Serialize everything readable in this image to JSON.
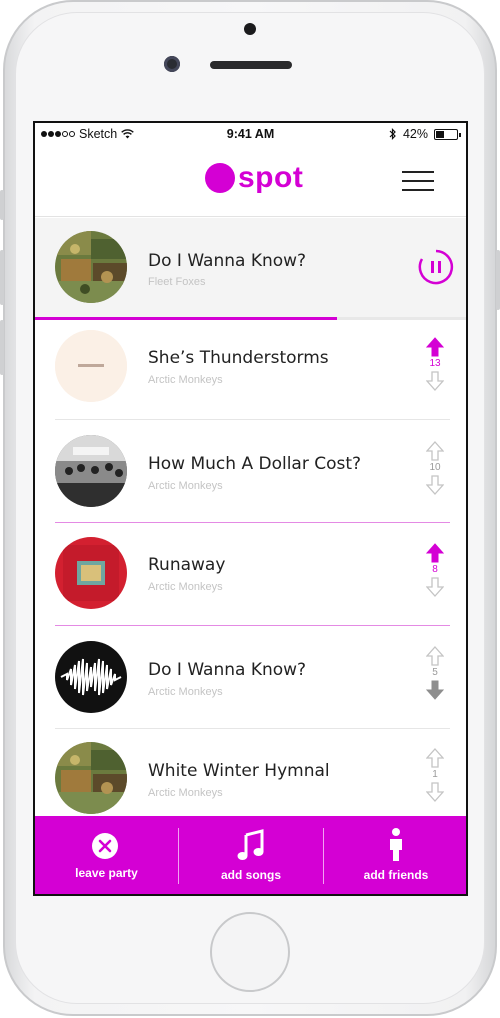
{
  "status": {
    "carrier": "Sketch",
    "time": "9:41 AM",
    "battery": "42%",
    "battery_level": 0.42
  },
  "brand": {
    "name": "spot",
    "color": "#d400d4"
  },
  "now_playing": {
    "title": "Do I Wanna Know?",
    "artist": "Fleet Foxes",
    "progress": 0.7,
    "state_icon": "pause-icon"
  },
  "queue": [
    {
      "title": "She’s Thunderstorms",
      "artist": "Arctic Monkeys",
      "votes": "13",
      "upvoted": true,
      "downvoted": false
    },
    {
      "title": "How Much A Dollar Cost?",
      "artist": "Arctic Monkeys",
      "votes": "10",
      "upvoted": false,
      "downvoted": false
    },
    {
      "title": "Runaway",
      "artist": "Arctic Monkeys",
      "votes": "8",
      "upvoted": true,
      "downvoted": false
    },
    {
      "title": "Do I Wanna Know?",
      "artist": "Arctic Monkeys",
      "votes": "5",
      "upvoted": false,
      "downvoted": true
    },
    {
      "title": "White Winter Hymnal",
      "artist": "Arctic Monkeys",
      "votes": "1",
      "upvoted": false,
      "downvoted": false
    }
  ],
  "tabs": [
    {
      "label": "leave party",
      "icon": "close-circle-icon"
    },
    {
      "label": "add songs",
      "icon": "music-note-icon"
    },
    {
      "label": "add friends",
      "icon": "person-icon"
    }
  ]
}
